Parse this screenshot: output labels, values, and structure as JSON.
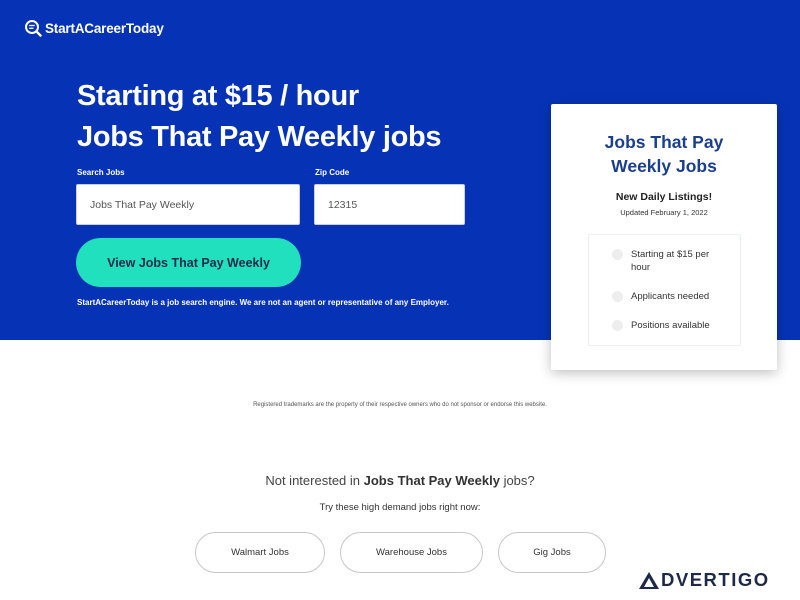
{
  "brand": {
    "name": "StartACareerToday",
    "icon": "search-chat-icon"
  },
  "hero": {
    "headline_line1": "Starting at $15 / hour",
    "headline_line2": "Jobs That Pay Weekly jobs",
    "search_label": "Search Jobs",
    "search_value": "Jobs That Pay Weekly",
    "zip_label": "Zip Code",
    "zip_value": "12315",
    "button_label": "View Jobs That Pay Weekly",
    "disclaimer": "StartACareerToday is a job search engine. We are not an agent or representative of any Employer.",
    "background_color": "#0633b5",
    "button_color": "#20e0bd"
  },
  "card": {
    "title_line1": "Jobs That Pay",
    "title_line2": "Weekly Jobs",
    "subtitle": "New Daily Listings!",
    "updated": "Updated February 1, 2022",
    "stats": [
      {
        "line1": "Starting at $15 per",
        "line2": "hour"
      },
      {
        "line1": "Applicants needed",
        "line2": ""
      },
      {
        "line1": "Positions available",
        "line2": ""
      }
    ]
  },
  "trademark": "Registered trademarks are the property of their respective owners who do not sponsor or endorse this website.",
  "more": {
    "prefix": "Not interested in ",
    "highlight": "Jobs That Pay Weekly",
    "suffix": " jobs?",
    "subtitle": "Try these high demand jobs right now:",
    "jobs": [
      "Walmart Jobs",
      "Warehouse Jobs",
      "Gig Jobs"
    ]
  },
  "watermark": {
    "text": "DVERTIGO",
    "icon": "advertigo-a-icon"
  }
}
